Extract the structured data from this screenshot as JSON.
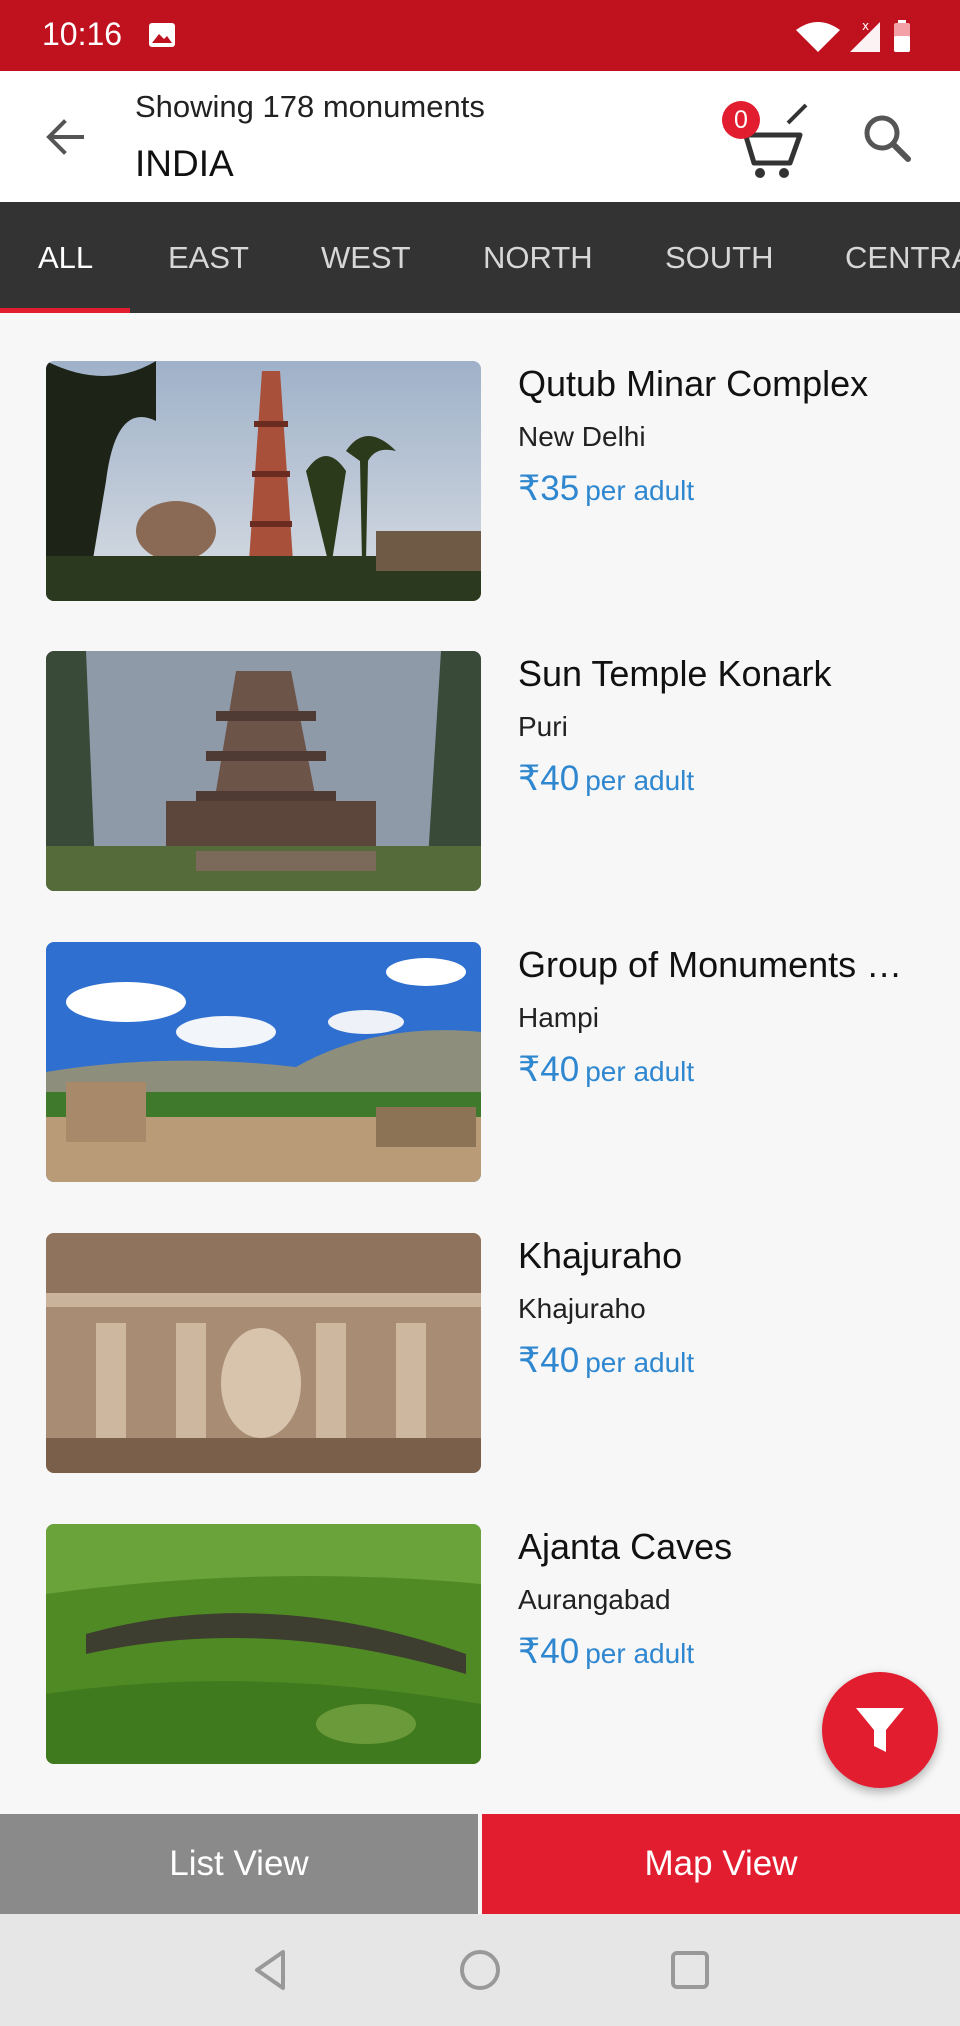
{
  "status_bar": {
    "time": "10:16",
    "icons": [
      "image-icon",
      "wifi-icon",
      "signal-icon",
      "battery-icon"
    ]
  },
  "app_bar": {
    "subtitle": "Showing 178 monuments",
    "title": "INDIA",
    "cart_count": "0"
  },
  "tabs": [
    {
      "label": "ALL",
      "active": true
    },
    {
      "label": "EAST"
    },
    {
      "label": "WEST"
    },
    {
      "label": "NORTH"
    },
    {
      "label": "SOUTH"
    },
    {
      "label": "CENTRAL"
    }
  ],
  "monuments": [
    {
      "name": "Qutub Minar Complex",
      "city": "New Delhi",
      "price": "₹35",
      "unit": "per adult"
    },
    {
      "name": "Sun Temple Konark",
      "city": "Puri",
      "price": "₹40",
      "unit": "per adult"
    },
    {
      "name": "Group of Monuments at Hampi",
      "city": "Hampi",
      "price": "₹40",
      "unit": "per adult"
    },
    {
      "name": "Khajuraho",
      "city": "Khajuraho",
      "price": "₹40",
      "unit": "per adult"
    },
    {
      "name": "Ajanta Caves",
      "city": "Aurangabad",
      "price": "₹40",
      "unit": "per adult"
    }
  ],
  "bottom": {
    "list_label": "List View",
    "map_label": "Map View"
  },
  "colors": {
    "primary_red": "#e21d2f",
    "status_red": "#c0111f",
    "tab_bg": "#333333",
    "price_blue": "#2f87d0"
  }
}
